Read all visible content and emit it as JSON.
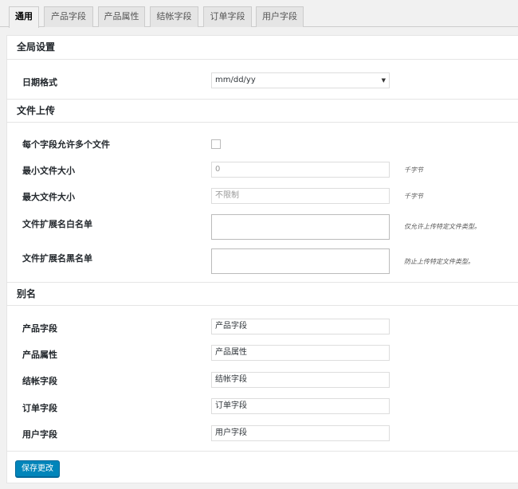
{
  "tabs": [
    {
      "label": "通用",
      "active": true
    },
    {
      "label": "产品字段"
    },
    {
      "label": "产品属性"
    },
    {
      "label": "结帐字段"
    },
    {
      "label": "订单字段"
    },
    {
      "label": "用户字段"
    }
  ],
  "global": {
    "heading": "全局设置",
    "date_format_label": "日期格式",
    "date_format_value": "mm/dd/yy"
  },
  "upload": {
    "heading": "文件上传",
    "multi_label": "每个字段允许多个文件",
    "multi_checked": false,
    "min_label": "最小文件大小",
    "min_placeholder": "0",
    "min_unit": "千字节",
    "max_label": "最大文件大小",
    "max_placeholder": "不限制",
    "max_unit": "千字节",
    "whitelist_label": "文件扩展名白名单",
    "whitelist_hint": "仅允许上传特定文件类型。",
    "blacklist_label": "文件扩展名黑名单",
    "blacklist_hint": "防止上传特定文件类型。"
  },
  "alias": {
    "heading": "别名",
    "rows": [
      {
        "label": "产品字段",
        "value": "产品字段"
      },
      {
        "label": "产品属性",
        "value": "产品属性"
      },
      {
        "label": "结帐字段",
        "value": "结帐字段"
      },
      {
        "label": "订单字段",
        "value": "订单字段"
      },
      {
        "label": "用户字段",
        "value": "用户字段"
      }
    ]
  },
  "save_label": "保存更改",
  "colors": {
    "primary_button": "#0085ba",
    "background": "#f1f1f1"
  }
}
